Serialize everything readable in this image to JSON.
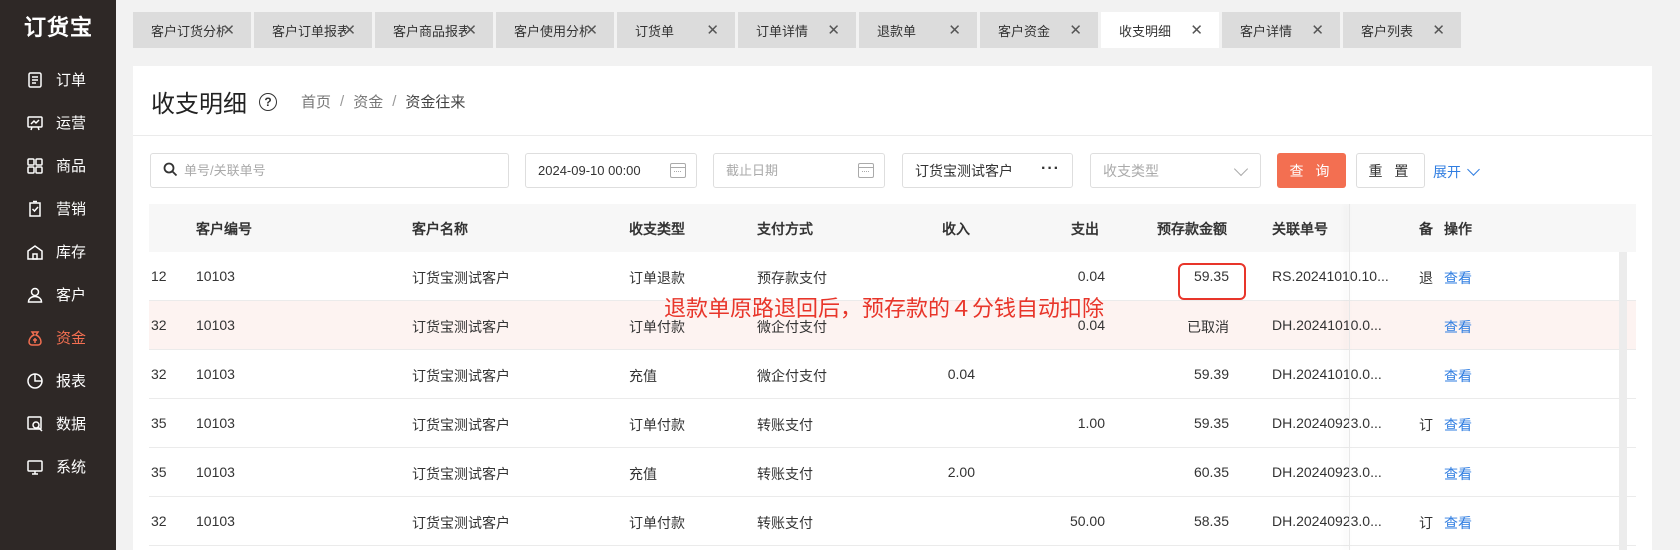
{
  "app": {
    "logo": "订货宝"
  },
  "sidebar": {
    "items": [
      {
        "label": "订单",
        "icon": "order-icon"
      },
      {
        "label": "运营",
        "icon": "operation-icon"
      },
      {
        "label": "商品",
        "icon": "product-icon"
      },
      {
        "label": "营销",
        "icon": "marketing-icon"
      },
      {
        "label": "库存",
        "icon": "inventory-icon"
      },
      {
        "label": "客户",
        "icon": "customer-icon"
      },
      {
        "label": "资金",
        "icon": "money-icon",
        "active": true
      },
      {
        "label": "报表",
        "icon": "pie-chart-icon"
      },
      {
        "label": "数据",
        "icon": "data-icon"
      },
      {
        "label": "系统",
        "icon": "monitor-icon"
      }
    ],
    "accent_color": "#f36f51"
  },
  "tabs": [
    {
      "label": "客户订货分析"
    },
    {
      "label": "客户订单报表"
    },
    {
      "label": "客户商品报表"
    },
    {
      "label": "客户使用分析"
    },
    {
      "label": "订货单"
    },
    {
      "label": "订单详情"
    },
    {
      "label": "退款单"
    },
    {
      "label": "客户资金"
    },
    {
      "label": "收支明细",
      "active": true
    },
    {
      "label": "客户详情"
    },
    {
      "label": "客户列表"
    }
  ],
  "page": {
    "title": "收支明细",
    "breadcrumb": [
      "首页",
      "资金",
      "资金往来"
    ]
  },
  "filters": {
    "search_placeholder": "单号/关联单号",
    "start_date": "2024-09-10 00:00",
    "end_placeholder": "截止日期",
    "customer": "订货宝测试客户",
    "type_placeholder": "收支类型",
    "query_label": "查 询",
    "reset_label": "重 置",
    "expand_label": "展开"
  },
  "table": {
    "headers": [
      "客户编号",
      "客户名称",
      "收支类型",
      "支付方式",
      "收入",
      "支出",
      "预存款金额",
      "关联单号",
      "备",
      "操作"
    ],
    "rows": [
      {
        "pre": "12",
        "code": "10103",
        "name": "订货宝测试客户",
        "type": "订单退款",
        "pay": "预存款支付",
        "income": "",
        "expense": "0.04",
        "balance": "59.35",
        "ref": "RS.20241010.10...",
        "note": "退",
        "op": "查看"
      },
      {
        "pre": "32",
        "code": "10103",
        "name": "订货宝测试客户",
        "type": "订单付款",
        "pay": "微企付支付",
        "income": "",
        "expense": "0.04",
        "balance": "已取消",
        "ref": "DH.20241010.0...",
        "note": "",
        "op": "查看"
      },
      {
        "pre": "32",
        "code": "10103",
        "name": "订货宝测试客户",
        "type": "充值",
        "pay": "微企付支付",
        "income": "0.04",
        "expense": "",
        "balance": "59.39",
        "ref": "DH.20241010.0...",
        "note": "",
        "op": "查看"
      },
      {
        "pre": "35",
        "code": "10103",
        "name": "订货宝测试客户",
        "type": "订单付款",
        "pay": "转账支付",
        "income": "",
        "expense": "1.00",
        "balance": "59.35",
        "ref": "DH.20240923.0...",
        "note": "订",
        "op": "查看"
      },
      {
        "pre": "35",
        "code": "10103",
        "name": "订货宝测试客户",
        "type": "充值",
        "pay": "转账支付",
        "income": "2.00",
        "expense": "",
        "balance": "60.35",
        "ref": "DH.20240923.0...",
        "note": "",
        "op": "查看"
      },
      {
        "pre": "32",
        "code": "10103",
        "name": "订货宝测试客户",
        "type": "订单付款",
        "pay": "转账支付",
        "income": "",
        "expense": "50.00",
        "balance": "58.35",
        "ref": "DH.20240923.0...",
        "note": "订",
        "op": "查看"
      }
    ]
  },
  "annotation": {
    "text": "退款单原路退回后，预存款的４分钱自动扣除",
    "color": "#e8352a"
  }
}
